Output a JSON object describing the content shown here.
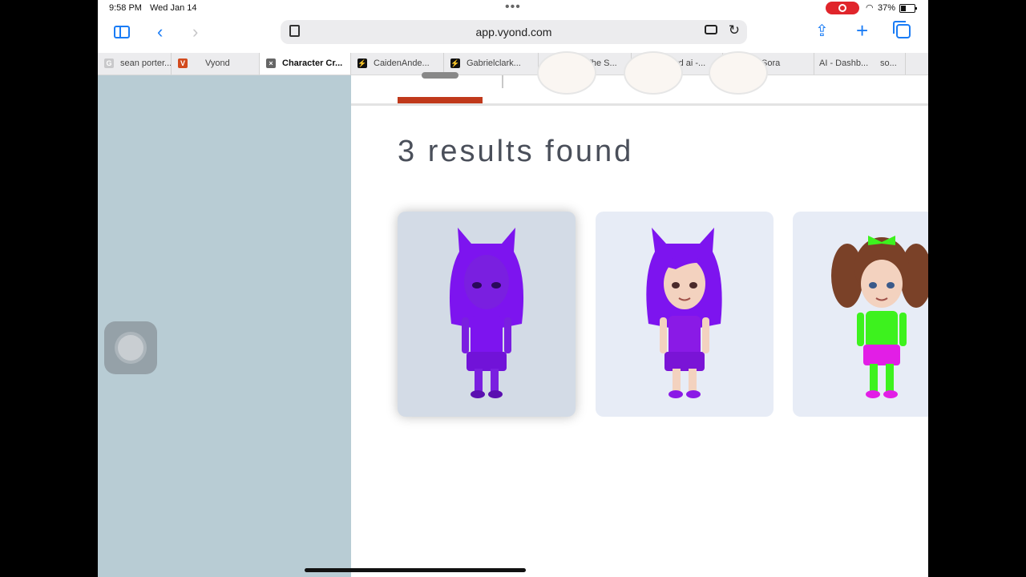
{
  "status_bar": {
    "time": "9:58 PM",
    "date": "Wed Jan 14",
    "battery": "37%"
  },
  "toolbar": {
    "url": "app.vyond.com"
  },
  "tabs": [
    {
      "label": "sean porter...",
      "favicon": "G",
      "active": false
    },
    {
      "label": "Vyond",
      "favicon": "V",
      "active": false
    },
    {
      "label": "Character Cr...",
      "favicon": "×",
      "active": true
    },
    {
      "label": "CaidenAnde...",
      "favicon": "⚡",
      "active": false
    },
    {
      "label": "Gabrielclark...",
      "favicon": "⚡",
      "active": false
    },
    {
      "label": "Riley (The S...",
      "favicon": "⚡",
      "active": false
    },
    {
      "label": "leonard ai -...",
      "favicon": "G",
      "active": false
    },
    {
      "label": "Sora",
      "favicon": "◎",
      "active": false
    },
    {
      "label": "AI - Dashb...",
      "favicon": "",
      "active": false
    },
    {
      "label": "so...",
      "favicon": "",
      "active": false
    }
  ],
  "main": {
    "results_title": "3 results found",
    "results": [
      {
        "name": "purple-cat-girl-character",
        "selected": true,
        "skin": "#7a1fe0",
        "hair": "#7d14ef",
        "outfit": "#7d14ef"
      },
      {
        "name": "purple-hair-girl-character",
        "selected": false,
        "skin": "#f3d2bf",
        "hair": "#7d14ef",
        "outfit": "#8a1ae6"
      },
      {
        "name": "brown-pigtails-girl-character",
        "selected": false,
        "skin": "#f3d2bf",
        "hair": "#7a4128",
        "outfit": "#3df21e"
      }
    ]
  },
  "colors": {
    "accent_underline": "#c0391b",
    "safari_blue": "#1a7cf5",
    "left_pane": "#b8ccd4"
  }
}
